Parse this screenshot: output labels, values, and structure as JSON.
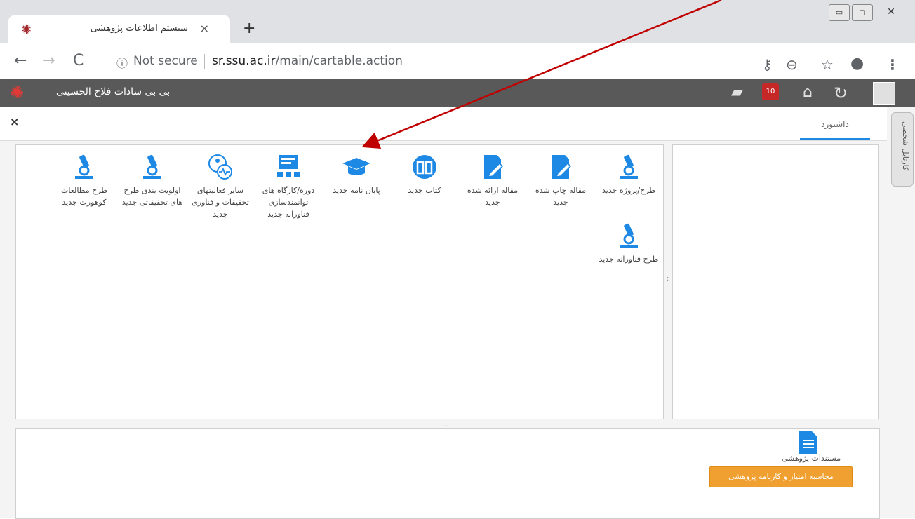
{
  "browser": {
    "tab_title": "سیستم اطلاعات پژوهشی",
    "new_tab_symbol": "+",
    "close_symbol": "×",
    "not_secure": "Not secure",
    "url_host": "sr.ssu.ac.ir",
    "url_path": "/main/cartable.action"
  },
  "header": {
    "user_name": "بی بی سادات فلاح الحسینی",
    "calendar_badge": "10"
  },
  "dashboard": {
    "tab_label": "داشبورد",
    "sidebar_label": "کارتابل شخصی",
    "close_symbol": "×",
    "splitter_h": "...",
    "splitter_v": ":",
    "tiles": [
      {
        "label": "طرح/پروژه جدید",
        "icon": "microscope-icon"
      },
      {
        "label": "مقاله چاپ شده جدید",
        "icon": "edit-icon"
      },
      {
        "label": "مقاله ارائه شده جدید",
        "icon": "edit-icon"
      },
      {
        "label": "کتاب جدید",
        "icon": "book-icon"
      },
      {
        "label": "پایان نامه جدید",
        "icon": "graduation-cap-icon"
      },
      {
        "label": "دوره/کارگاه های توانمندسازی فناورانه جدید",
        "icon": "presentation-icon"
      },
      {
        "label": "سایر فعالیتهای تحقیقات و فناوری جدید",
        "icon": "activity-icon"
      },
      {
        "label": "اولویت بندی طرح های تحقیقاتی جدید",
        "icon": "microscope-icon"
      },
      {
        "label": "طرح مطالعات کوهورت جدید",
        "icon": "microscope-icon"
      },
      {
        "label": "طرح فناورانه جدید",
        "icon": "microscope-icon"
      }
    ]
  },
  "bottom": {
    "documents_label": "مستندات پژوهشی",
    "calc_button": "محاسبه امتیاز و کارنامه پژوهشی"
  },
  "colors": {
    "accent": "#1e88e5",
    "header_bg": "#595959",
    "button_orange": "#f0a030",
    "annotation_arrow": "#c00000"
  }
}
